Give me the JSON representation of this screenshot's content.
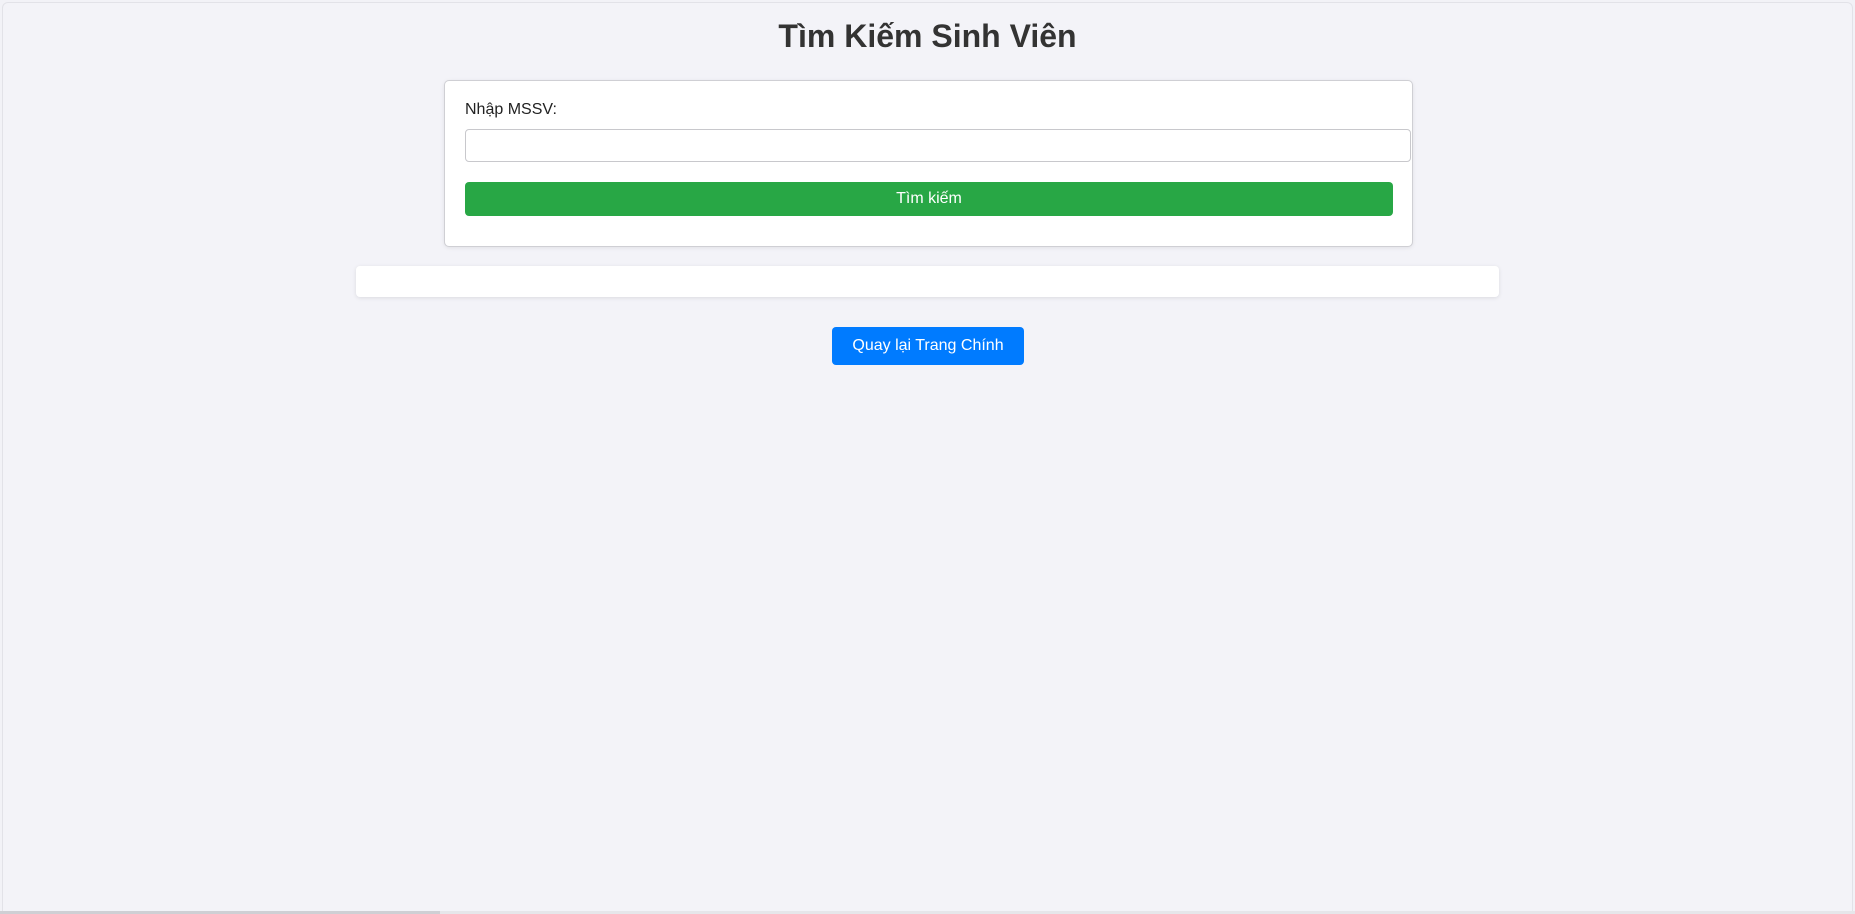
{
  "page": {
    "title": "Tìm Kiếm Sinh Viên"
  },
  "search_form": {
    "label": "Nhập MSSV:",
    "input_value": "",
    "input_placeholder": "",
    "submit_label": "Tìm kiếm"
  },
  "result": {
    "text": ""
  },
  "navigation": {
    "back_label": "Quay lại Trang Chính"
  },
  "colors": {
    "background": "#f3f3f8",
    "search_button": "#28a745",
    "back_button": "#007bff",
    "title_text": "#333333"
  }
}
